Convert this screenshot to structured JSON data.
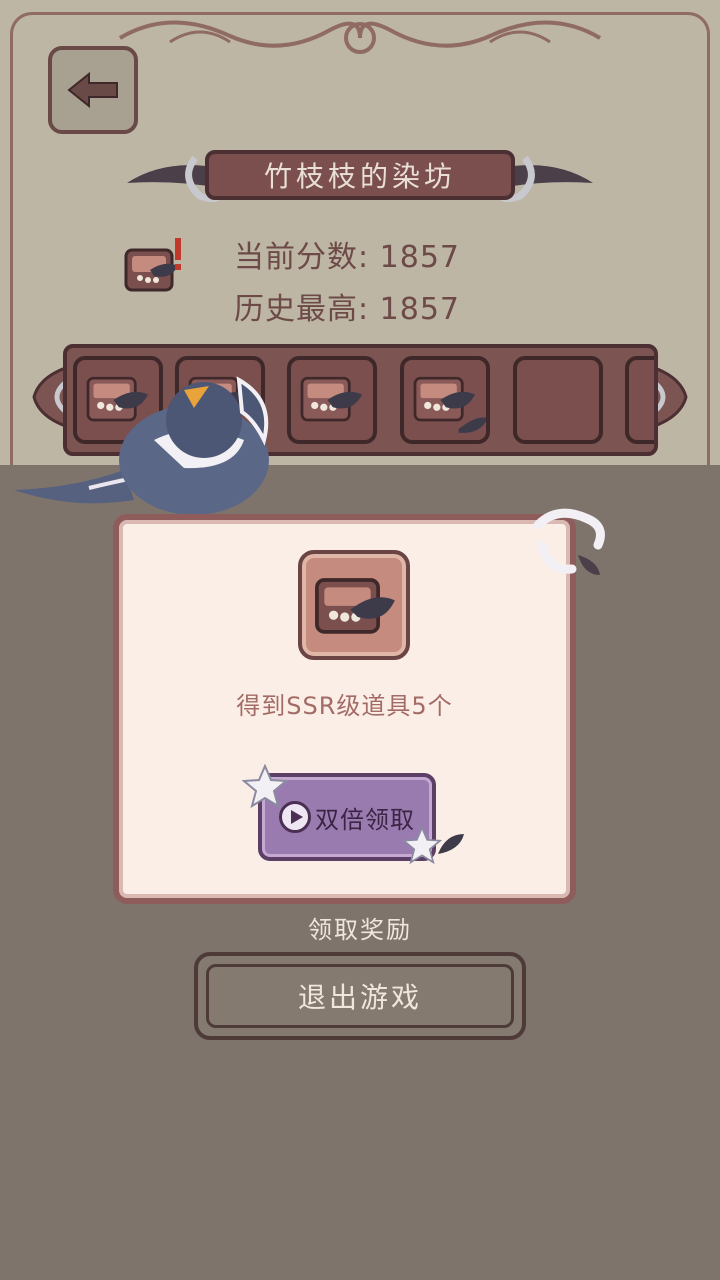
{
  "header": {
    "back_icon": "arrow-left-icon",
    "title": "竹枝枝的染坊"
  },
  "scores": {
    "current": "当前分数: 1857",
    "best": "历史最高: 1857"
  },
  "slots": {
    "filled_count": 4,
    "item_icon": "jewelry-box-icon"
  },
  "popup": {
    "reward_icon": "jewelry-box-icon",
    "reward_text": "得到SSR级道具5个",
    "double_button_label": "双倍领取",
    "play_icon": "play-icon"
  },
  "claim_label": "领取奖励",
  "exit_label": "退出游戏",
  "colors": {
    "background": "#7e746c",
    "parchment": "#bdb6a4",
    "plate": "#7a4f4e",
    "popup_bg": "#fbeee6",
    "double_button": "#9a7bb0"
  }
}
